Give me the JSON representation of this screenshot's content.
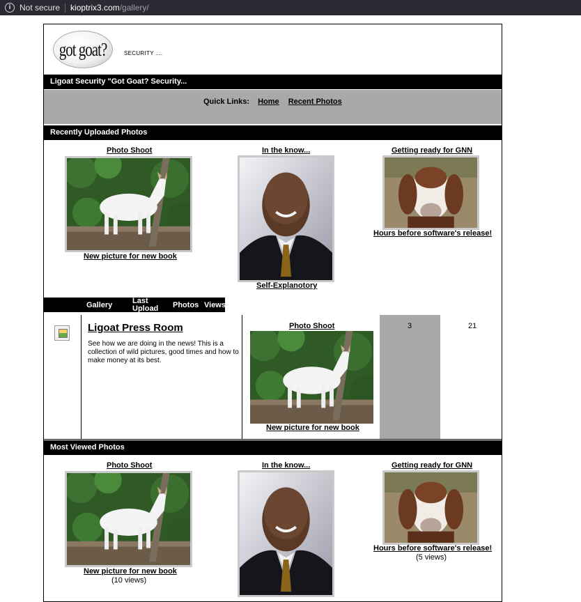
{
  "browser": {
    "security": "Not secure",
    "url_host": "kioptrix3.com",
    "url_path": "/gallery/"
  },
  "header": {
    "logo_text": "got goat?",
    "tagline": "SECURITY ...."
  },
  "title_bar": "Ligoat Security \"Got Goat? Security...",
  "quick_links": {
    "label": "Quick Links:",
    "items": [
      "Home",
      "Recent Photos"
    ]
  },
  "recent": {
    "title": "Recently Uploaded Photos",
    "photos": [
      {
        "title": "Photo Shoot",
        "caption": "New picture for new book",
        "image": "white-goat-photo"
      },
      {
        "title": "In the know...",
        "caption": "Self-Explanotory",
        "image": "man-portrait-photo"
      },
      {
        "title": "Getting ready for GNN",
        "caption": "Hours before software's release!",
        "image": "brown-goat-photo"
      }
    ]
  },
  "gallery_table": {
    "headers": [
      "Gallery",
      "Last Upload",
      "Photos",
      "Views"
    ],
    "row": {
      "name": "Ligoat Press Room",
      "description": "See how we are doing in the news! This is a collection of wild pictures, good times and how to make money at its best.",
      "last_upload_title": "Photo Shoot",
      "last_upload_caption": "New picture for new book",
      "photos": "3",
      "views": "21"
    }
  },
  "most_viewed": {
    "title": "Most Viewed Photos",
    "photos": [
      {
        "title": "Photo Shoot",
        "caption": "New picture for new book",
        "views": "(10 views)"
      },
      {
        "title": "In the know...",
        "caption": "",
        "views": ""
      },
      {
        "title": "Getting ready for GNN",
        "caption": "Hours before software's release!",
        "views": "(5 views)"
      }
    ]
  }
}
